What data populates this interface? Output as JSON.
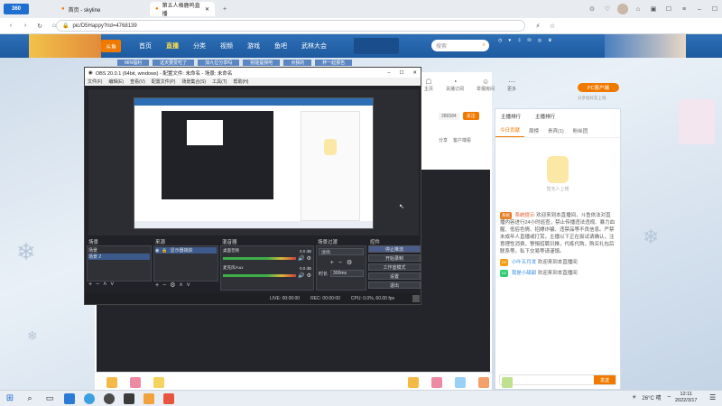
{
  "browser": {
    "tab1_label": "首页 - skyline",
    "tab2_label": "第五人格鹿呜直播",
    "url": "pic/D5Happy?rid=4768139"
  },
  "site": {
    "logo": "斗鱼",
    "nav": [
      "首页",
      "直播",
      "分类",
      "视频",
      "游戏",
      "鱼吧",
      "武林大会"
    ],
    "search_placeholder": "搜索",
    "user_icons": [
      "历史",
      "关注",
      "下载",
      "消息",
      "鱼翅"
    ],
    "banner_items": [
      "MIN福利",
      "这天要爱吃了",
      "加九位分享吗",
      "别能提我吧",
      "点我的",
      "杯一起报告"
    ]
  },
  "room": {
    "actions": [
      "主页",
      "关播订阅",
      "举报房间",
      "更多"
    ],
    "pc_button": "PC客户端",
    "pc_sub": "分享给好友上线",
    "follow_count": "286584",
    "follow_button": "关注",
    "share": "分享",
    "client_watch": "客户端看"
  },
  "obs": {
    "title": "OBS 20.0.1 (64bit, windows) - 配置文件: 未命名 - 场景: 未命名",
    "menu": [
      "文件(F)",
      "编辑(E)",
      "查看(V)",
      "配置文件(P)",
      "场景集合(S)",
      "工具(T)",
      "帮助(H)"
    ],
    "scenes_label": "场景",
    "scenes": [
      "场景",
      "场景 2"
    ],
    "sources_label": "来源",
    "sources": [
      "显示器捕获"
    ],
    "mixer_label": "混音器",
    "mixer": [
      {
        "name": "桌面音频",
        "level": "0.0 dB"
      },
      {
        "name": "麦克风/Aux",
        "level": "0.0 dB"
      }
    ],
    "transition_label": "场景过渡",
    "transition_value": "淡出",
    "duration_label": "时长",
    "duration_value": "300ms",
    "controls_label": "控件",
    "controls": [
      "停止推流",
      "开始录制",
      "工作室模式",
      "设置",
      "退出"
    ],
    "status": {
      "live": "LIVE: 00:00:00",
      "rec": "REC: 00:00:00",
      "cpu": "CPU: 0.0%, 60.00 fps"
    }
  },
  "panel": {
    "tabs": [
      "今日贡献",
      "周榜",
      "贵宾(1)",
      "粉丝团"
    ],
    "header_tabs": [
      "主播排行",
      "主播排行"
    ],
    "promo_text": "暂无人上榜",
    "chat": [
      {
        "badge": "系统",
        "who": "系统提示",
        "msg": "欢迎来到本直播间，斗鱼依法对直播内容进行24小时巡查，禁止传播违法违规、暴力血腥、低俗色情、招嫖诈骗、违禁品等不良信息。严禁未成年人直播或打赏，主播以下正在尝试请确认，注意理性消费，警惕招聘日推，代练代购，购买礼包后联系等，私下交易等请谨慎。"
      },
      {
        "badge": "LV",
        "who": "小叶五月发",
        "msg": "欢迎来到本直播间"
      },
      {
        "badge": "LV",
        "who": "我是小甜甜",
        "msg": "欢迎来到本直播间"
      }
    ],
    "send_button": "发送"
  },
  "taskbar": {
    "weather": "26°C 晴",
    "time": "12:11",
    "date": "2022/3/17"
  }
}
